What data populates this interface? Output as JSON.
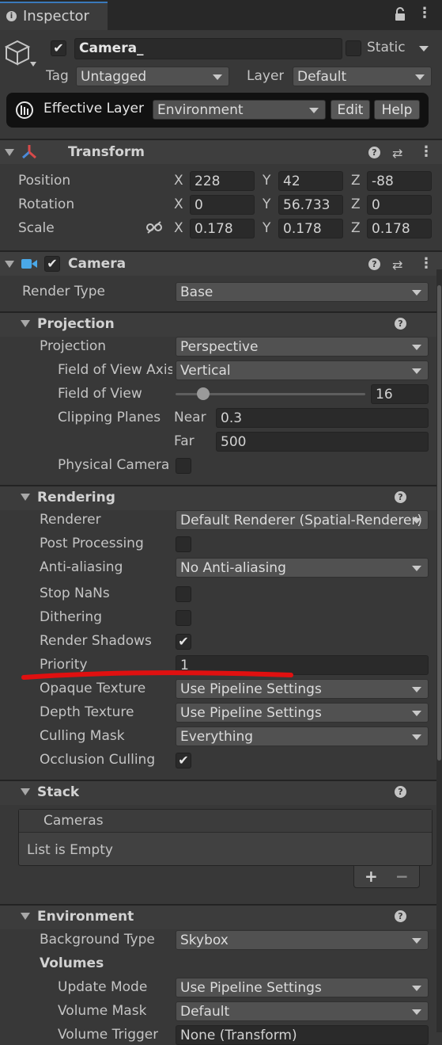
{
  "window": {
    "tab_title": "Inspector"
  },
  "object": {
    "name": "Camera_",
    "static_label": "Static",
    "tag_label": "Tag",
    "tag_value": "Untagged",
    "layer_label": "Layer",
    "layer_value": "Default",
    "effective_layer_label": "Effective Layer",
    "effective_layer_value": "Environment",
    "edit_label": "Edit",
    "help_label": "Help"
  },
  "transform": {
    "title": "Transform",
    "position_label": "Position",
    "rotation_label": "Rotation",
    "scale_label": "Scale",
    "x": "X",
    "y": "Y",
    "z": "Z",
    "position": [
      "228",
      "42",
      "-88"
    ],
    "rotation": [
      "0",
      "56.733",
      "0"
    ],
    "scale": [
      "0.178",
      "0.178",
      "0.178"
    ]
  },
  "camera": {
    "title": "Camera",
    "render_type_label": "Render Type",
    "render_type_value": "Base",
    "projection": {
      "title": "Projection",
      "projection_label": "Projection",
      "projection_value": "Perspective",
      "fov_axis_label": "Field of View Axis",
      "fov_axis_value": "Vertical",
      "fov_label": "Field of View",
      "fov_value": "16",
      "fov_slider_fraction": 0.12,
      "clipping_label": "Clipping Planes",
      "near_label": "Near",
      "near_value": "0.3",
      "far_label": "Far",
      "far_value": "500",
      "physical_label": "Physical Camera"
    },
    "rendering": {
      "title": "Rendering",
      "renderer_label": "Renderer",
      "renderer_value": "Default Renderer (Spatial-Renderer)",
      "post_label": "Post Processing",
      "aa_label": "Anti-aliasing",
      "aa_value": "No Anti-aliasing",
      "stopnans_label": "Stop NaNs",
      "dithering_label": "Dithering",
      "shadows_label": "Render Shadows",
      "priority_label": "Priority",
      "priority_value": "1",
      "opaque_label": "Opaque Texture",
      "opaque_value": "Use Pipeline Settings",
      "depth_label": "Depth Texture",
      "depth_value": "Use Pipeline Settings",
      "culling_label": "Culling Mask",
      "culling_value": "Everything",
      "occlusion_label": "Occlusion Culling"
    },
    "stack": {
      "title": "Stack",
      "list_header": "Cameras",
      "empty_text": "List is Empty"
    },
    "environment": {
      "title": "Environment",
      "bg_label": "Background Type",
      "bg_value": "Skybox",
      "volumes_label": "Volumes",
      "update_label": "Update Mode",
      "update_value": "Use Pipeline Settings",
      "mask_label": "Volume Mask",
      "mask_value": "Default",
      "trigger_label": "Volume Trigger",
      "trigger_value": "None (Transform)"
    }
  },
  "colors": {
    "background": "#383838",
    "field": "#2a2a2a",
    "annotation_red": "#e01010"
  }
}
